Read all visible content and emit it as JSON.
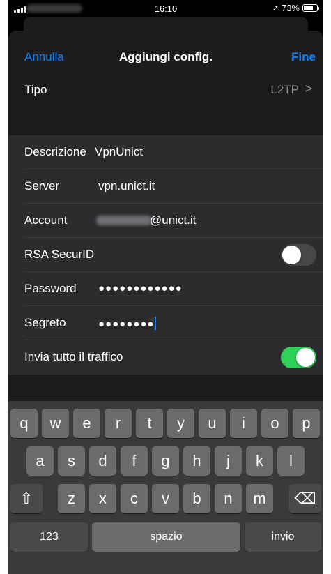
{
  "status_bar": {
    "time": "16:10",
    "battery": "73%",
    "battery_level": 0.73
  },
  "nav": {
    "cancel": "Annulla",
    "title": "Aggiungi config.",
    "done": "Fine"
  },
  "tipo": {
    "label": "Tipo",
    "value": "L2TP",
    "chevron": ">"
  },
  "fields": {
    "descrizione": {
      "label": "Descrizione",
      "value": "VpnUnict"
    },
    "server": {
      "label": "Server",
      "value": "vpn.unict.it"
    },
    "account": {
      "label": "Account",
      "value": "@unict.it"
    },
    "rsa": {
      "label": "RSA SecurID",
      "on": false
    },
    "password": {
      "label": "Password",
      "value": "●●●●●●●●●●●●"
    },
    "segreto": {
      "label": "Segreto",
      "value": "●●●●●●●●"
    },
    "invia": {
      "label": "Invia tutto il traffico",
      "on": true
    }
  },
  "keyboard": {
    "row1": [
      "q",
      "w",
      "e",
      "r",
      "t",
      "y",
      "u",
      "i",
      "o",
      "p"
    ],
    "row2": [
      "a",
      "s",
      "d",
      "f",
      "g",
      "h",
      "j",
      "k",
      "l"
    ],
    "row3": [
      "z",
      "x",
      "c",
      "v",
      "b",
      "n",
      "m"
    ],
    "shift": "⇧",
    "backspace": "⌫",
    "numbers": "123",
    "space": "spazio",
    "return": "invio"
  },
  "colors": {
    "accent": "#0a84ff",
    "toggle_on": "#30d158"
  }
}
